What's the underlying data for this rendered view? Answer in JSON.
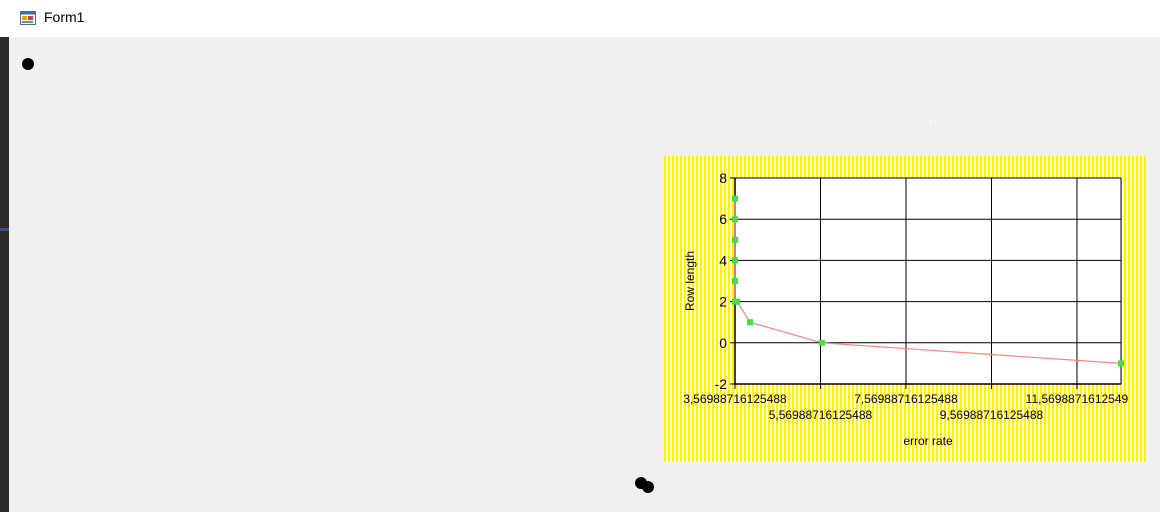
{
  "window": {
    "title": "Form1",
    "icon": "form-window-icon"
  },
  "chart_data": {
    "type": "line",
    "title": "",
    "xlabel": "error rate",
    "ylabel": "Row length",
    "x_ticks": [
      "3,56988716125488",
      "5,56988716125488",
      "7,56988716125488",
      "9,56988716125488",
      "11,5698871612549"
    ],
    "x_tick_values": [
      3.56988716125488,
      5.56988716125488,
      7.56988716125488,
      9.56988716125488,
      11.5698871612549
    ],
    "y_ticks": [
      "8",
      "6",
      "4",
      "2",
      "0",
      "-2"
    ],
    "y_tick_values": [
      8,
      6,
      4,
      2,
      0,
      -2
    ],
    "xlim": [
      3.56988716125488,
      12.6
    ],
    "ylim": [
      -2,
      8
    ],
    "grid": true,
    "series": [
      {
        "x": [
          3.57,
          3.57,
          3.57,
          3.57,
          3.57,
          3.57,
          3.62,
          3.92,
          5.6,
          12.6
        ],
        "y": [
          7,
          6,
          5,
          4,
          3,
          2,
          2,
          1,
          0,
          -1
        ],
        "line_color": "#ff8080",
        "marker_color": "#40e040"
      }
    ],
    "plot_background": "#ffffff",
    "chart_background": "#fff200"
  }
}
